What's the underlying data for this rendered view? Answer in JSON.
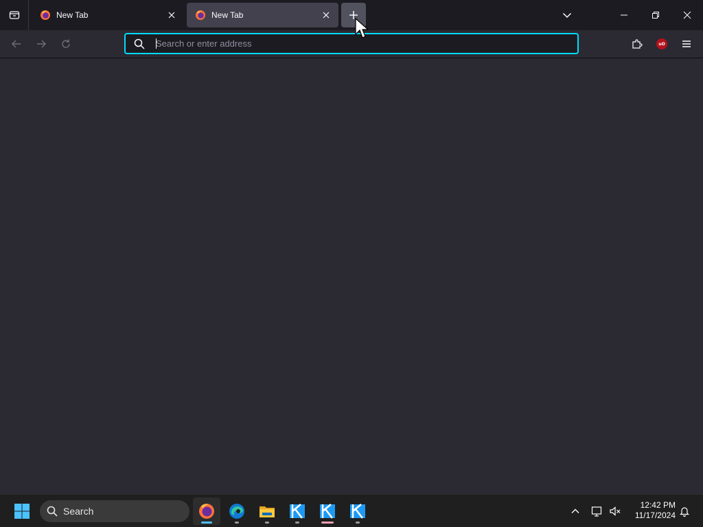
{
  "browser": {
    "tabs": [
      {
        "label": "New Tab",
        "icon": "firefox-icon"
      },
      {
        "label": "New Tab",
        "icon": "firefox-icon",
        "selected": true
      }
    ],
    "urlbar": {
      "placeholder": "Search or enter address",
      "value": ""
    },
    "accent": "#00ddff",
    "ublock_label": "uO"
  },
  "taskbar": {
    "search_label": "Search",
    "time": "12:42 PM",
    "date": "11/17/2024",
    "apps": [
      "firefox-icon",
      "edge-icon",
      "file-explorer-icon",
      "kdenlive-icon",
      "kdenlive-icon",
      "kdenlive-icon"
    ]
  }
}
